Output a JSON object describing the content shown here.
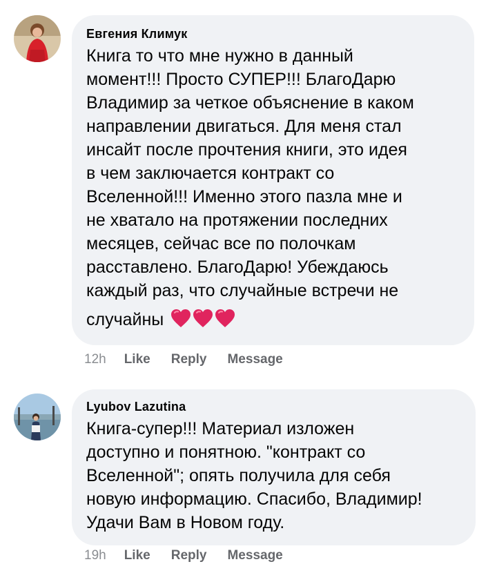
{
  "comments": [
    {
      "author": "Евгения Климук",
      "text_lines": [
        "Книга то что мне нужно в данный",
        "момент!!! Просто СУПЕР!!! БлагоДарю",
        "Владимир за четкое объяснение в каком",
        "направлении двигаться. Для меня стал",
        "инсайт после прочтения книги, это идея",
        "в чем заключается контракт со",
        "Вселенной!!! Именно этого пазла мне и",
        "не хватало на протяжении последних",
        "месяцев, сейчас все по полочкам",
        "расставлено. БлагоДарю! Убеждаюсь",
        "каждый раз, что случайные встречи не",
        "случайны"
      ],
      "emoji": "heart-icon x3",
      "time": "12h",
      "like": "Like",
      "reply": "Reply",
      "message": "Message"
    },
    {
      "author": "Lyubov Lazutina",
      "text_lines": [
        "Книга-супер!!!  Материал изложен",
        "доступно и понятною.  \"контракт со",
        "Вселенной\"; опять получила  для себя",
        "новую информацию. Спасибо, Владимир!",
        "Удачи Вам в Новом году."
      ],
      "time": "19h",
      "like": "Like",
      "reply": "Reply",
      "message": "Message"
    }
  ],
  "colors": {
    "bubble": "#f0f2f5",
    "text": "#050505",
    "secondary": "#65676b",
    "heart": "#e0245e"
  }
}
